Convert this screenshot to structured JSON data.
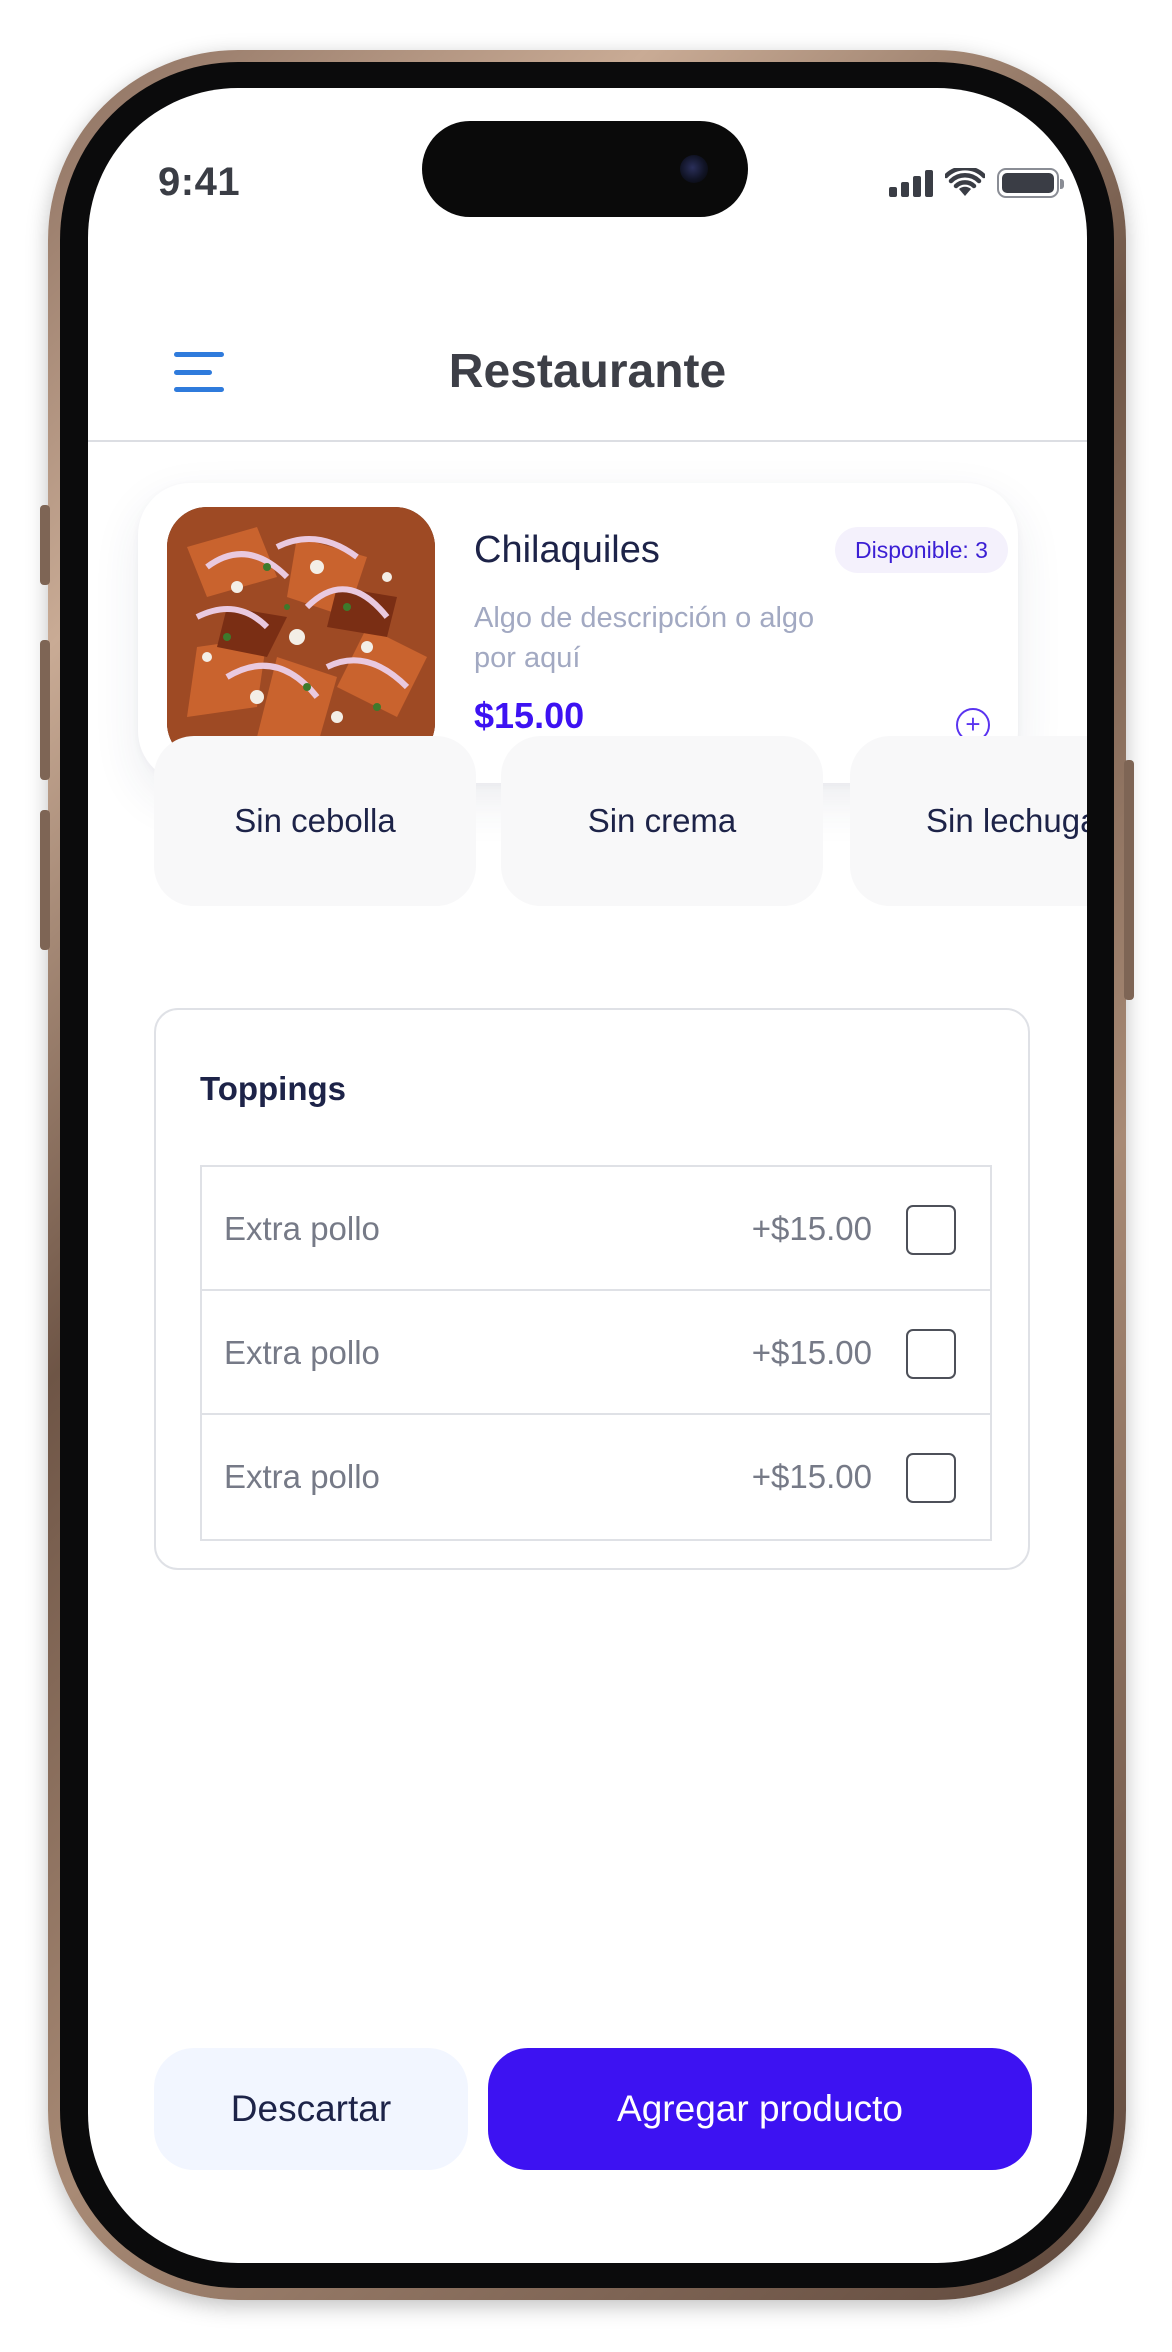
{
  "status_bar": {
    "time": "9:41"
  },
  "header": {
    "title": "Restaurante",
    "menu_icon": "hamburger-menu-icon"
  },
  "product": {
    "name": "Chilaquiles",
    "availability": "Disponible: 3",
    "description": "Algo de descripción o algo por aquí",
    "price": "$15.00",
    "add_icon": "plus-circle-icon"
  },
  "options": [
    {
      "label": "Sin cebolla"
    },
    {
      "label": "Sin crema"
    },
    {
      "label": "Sin lechuga"
    }
  ],
  "toppings": {
    "title": "Toppings",
    "items": [
      {
        "name": "Extra pollo",
        "price": "+$15.00",
        "checked": false
      },
      {
        "name": "Extra pollo",
        "price": "+$15.00",
        "checked": false
      },
      {
        "name": "Extra pollo",
        "price": "+$15.00",
        "checked": false
      }
    ]
  },
  "actions": {
    "discard_label": "Descartar",
    "add_label": "Agregar producto"
  },
  "colors": {
    "accent": "#3D12F2",
    "menu_icon": "#2F7BDC",
    "text_dark": "#1D2348"
  }
}
